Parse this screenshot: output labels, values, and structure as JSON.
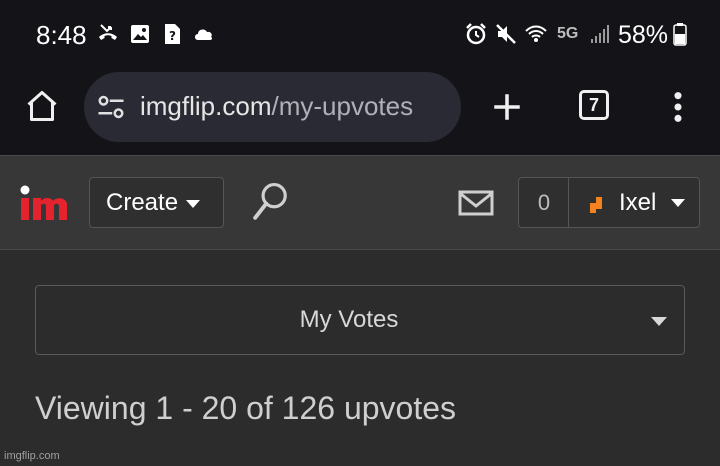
{
  "status_bar": {
    "time": "8:48",
    "network": "5G",
    "battery": "58%",
    "left_icons": [
      "missed-call-icon",
      "gallery-icon",
      "unknown-file-icon",
      "cloud-icon"
    ],
    "right_icons": [
      "alarm-icon",
      "mute-icon",
      "wifi-icon",
      "signal-icon",
      "battery-icon"
    ]
  },
  "browser": {
    "url_domain": "imgflip.com",
    "url_path": "/my-upvotes",
    "tab_count": "7",
    "icons": [
      "home-icon",
      "site-settings-icon",
      "new-tab-icon",
      "more-options-icon"
    ]
  },
  "header": {
    "logo": "im",
    "create_label": "Create",
    "notification_count": "0",
    "username": "Ixel",
    "colors": {
      "logo_red": "#e5232e",
      "avatar_orange": "#f5821f"
    }
  },
  "main": {
    "select_value": "My Votes",
    "viewing_text": "Viewing 1 - 20 of 126 upvotes"
  },
  "watermark": "imgflip.com"
}
